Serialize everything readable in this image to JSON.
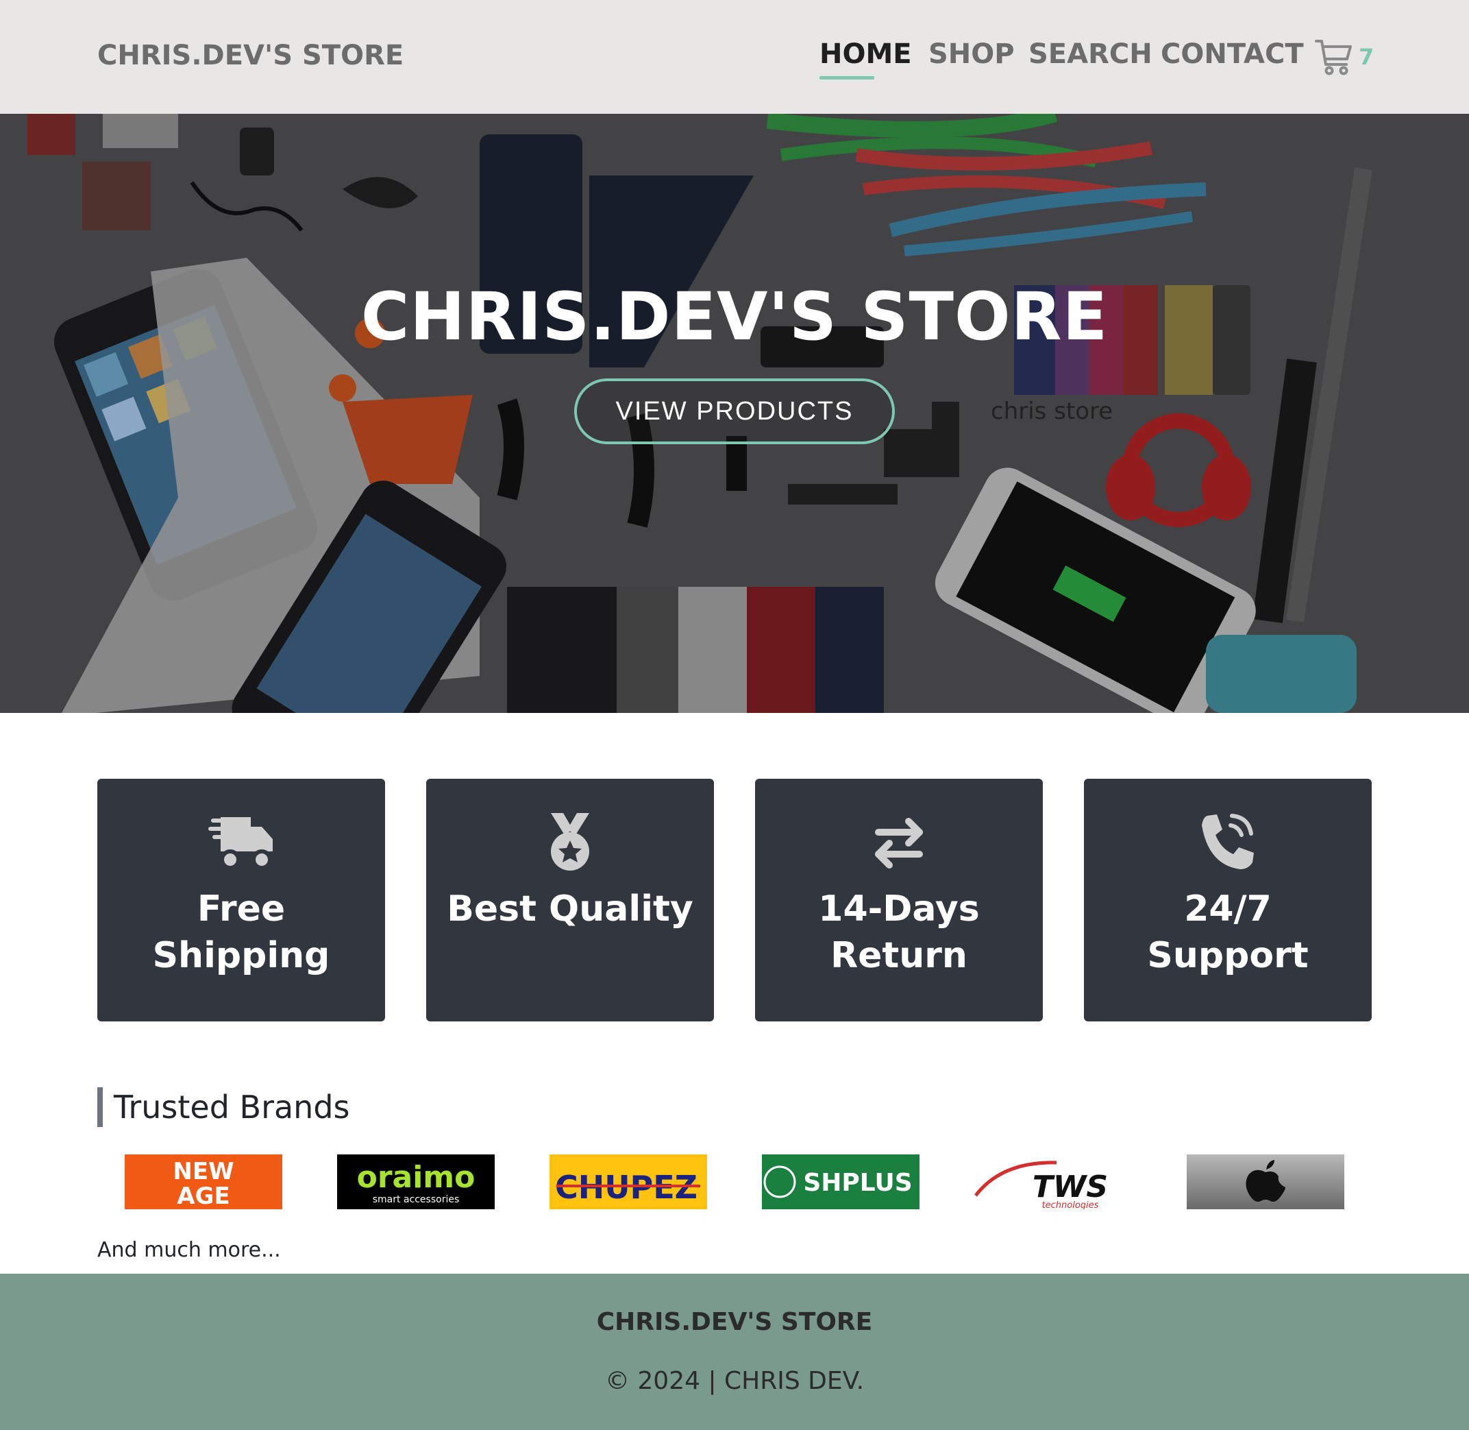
{
  "navbar": {
    "brand": "CHRIS.DEV'S STORE",
    "links": [
      {
        "label": "HOME",
        "active": true
      },
      {
        "label": "SHOP",
        "active": false
      },
      {
        "label": "SEARCH",
        "active": false
      },
      {
        "label": "CONTACT",
        "active": false
      }
    ],
    "cart_icon": "shopping-cart-icon",
    "cart_count": "7"
  },
  "hero": {
    "title": "CHRIS.DEV'S STORE",
    "button_label": "VIEW PRODUCTS",
    "watermark": "chris store"
  },
  "features": [
    {
      "icon": "truck-fast-icon",
      "label": "Free Shipping"
    },
    {
      "icon": "medal-icon",
      "label": "Best Quality"
    },
    {
      "icon": "arrows-exchange-icon",
      "label": "14-Days Return"
    },
    {
      "icon": "phone-volume-icon",
      "label": "24/7 Support"
    }
  ],
  "brands": {
    "title": "Trusted Brands",
    "logos": [
      {
        "name": "NEW AGE",
        "text_line1": "NEW",
        "text_line2": "AGE"
      },
      {
        "name": "oraimo",
        "text": "oraimo",
        "subtext": "smart accessories"
      },
      {
        "name": "CHUPEZ",
        "text": "CHUPEZ"
      },
      {
        "name": "SHPLUS",
        "text": "SHPLUS"
      },
      {
        "name": "TWS",
        "text": "TWS",
        "subtext": "technologies"
      },
      {
        "name": "Apple",
        "text": ""
      }
    ],
    "more": "And much more..."
  },
  "footer": {
    "title": "CHRIS.DEV'S STORE",
    "copyright": "© 2024 | CHRIS DEV."
  },
  "colors": {
    "accent": "#7fc8b0",
    "navbar_bg": "#e9e7e5",
    "feature_bg": "#32363e",
    "footer_bg": "#7a9a8e"
  }
}
